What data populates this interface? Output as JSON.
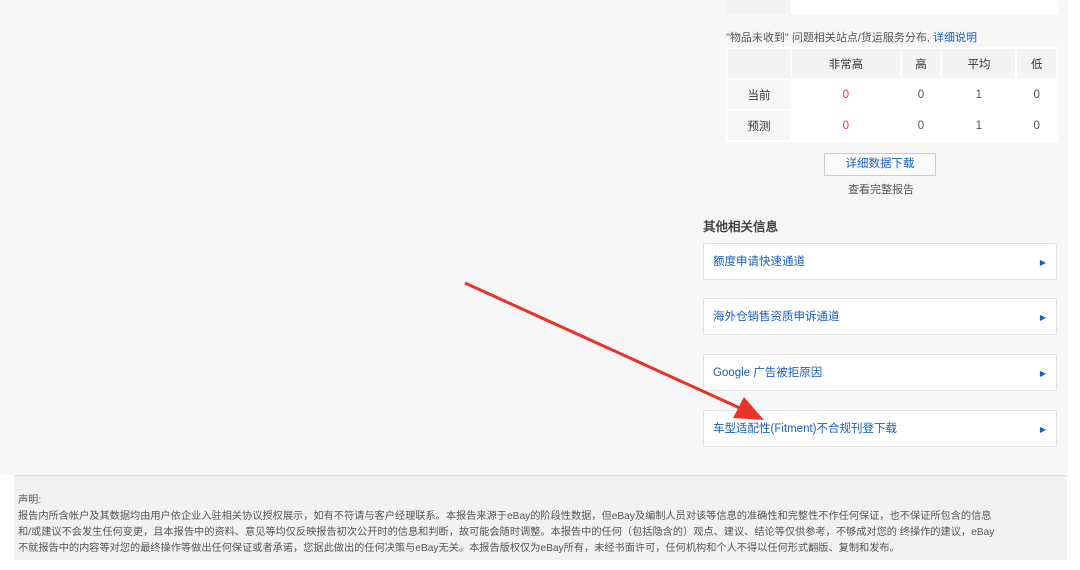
{
  "caption": {
    "text": "\"物品未收到\" 问题相关站点/货运服务分布, ",
    "link": "详细说明"
  },
  "table": {
    "headers": [
      "",
      "非常高",
      "高",
      "平均",
      "低"
    ],
    "rows": [
      {
        "label": "当前",
        "values": [
          "0",
          "0",
          "1",
          "0"
        ]
      },
      {
        "label": "预测",
        "values": [
          "0",
          "0",
          "1",
          "0"
        ]
      }
    ]
  },
  "download_button": "详细数据下载",
  "full_report": "查看完整报告",
  "other_title": "其他相关信息",
  "links": [
    "额度申请快速通道",
    "海外仓销售资质申诉通道",
    "Google 广告被拒原因",
    "车型适配性(Fitment)不合规刊登下载"
  ],
  "footer": {
    "title": "声明:",
    "lines": [
      "报告内所含帐户及其数据均由用户依企业入驻相关协议授权展示，如有不符请与客户经理联系。本报告来源于eBay的阶段性数据，但eBay及编制人员对该等信息的准确性和完整性不作任何保证，也不保证所包含的信息",
      "和/或建议不会发生任何变更，且本报告中的资料、意见等均仅反映报告初次公开时的信息和判断，故可能会随时调整。本报告中的任何（包括隐含的）观点、建议、结论等仅供参考，不够成对您的 终操作的建议，eBay",
      "不就报告中的内容等对您的最终操作等做出任何保证或者承诺，您据此做出的任何决策与eBay无关。本报告版权仅为eBay所有，未经书面许可，任何机构和个人不得以任何形式翻版、复制和发布。"
    ]
  },
  "colors": {
    "link": "#1a5fbf",
    "highlight": "#e5383b",
    "annotation_arrow": "#e8322a"
  }
}
